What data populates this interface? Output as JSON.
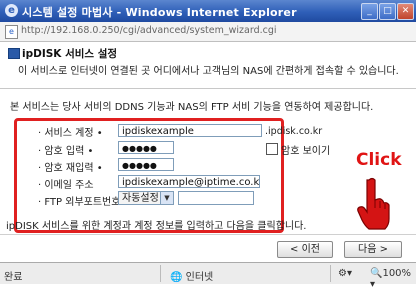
{
  "window": {
    "title": "시스템 설정 마법사 - Windows Internet Explorer",
    "url": "http://192.168.0.250/cgi/advanced/system_wizard.cgi",
    "minimize": "_",
    "maximize": "□",
    "close": "✕"
  },
  "header": {
    "title": "ipDISK 서비스 설정",
    "subtitle": "이 서비스로 인터넷이 연결된 곳 어디에서나 고객님의 NAS에 간편하게 접속할 수 있습니다."
  },
  "intro": "본 서비스는 당사 서비의 DDNS 기능과 NAS의 FTP 서비 기능을 연동하여 제공합니다.",
  "form": {
    "service_account_label": "· 서비스 계정 •",
    "service_account_value": "ipdiskexample",
    "domain_suffix": ".ipdisk.co.kr",
    "password_label": "· 암호 입력 •",
    "password_value": "●●●●●",
    "password_confirm_label": "· 암호 재입력 •",
    "password_confirm_value": "●●●●●",
    "show_password_label": "암호 보이기",
    "email_label": "· 이메일 주소",
    "email_value": "ipdiskexample@iptime.co.kr",
    "ftp_port_label": "· FTP 외부포트번호",
    "ftp_port_option": "자동설정"
  },
  "note": "ipDISK 서비스를 위한 계정과 계정 정보를 입력하고 다음을 클릭합니다.",
  "buttons": {
    "prev": "< 이전",
    "next": "다음 >"
  },
  "annotation": "Click",
  "statusbar": {
    "left": "완료",
    "zone": "인터넷",
    "zoom": "100%"
  },
  "colors": {
    "highlight": "#e02020",
    "titlebar": "#2f5fb8"
  }
}
